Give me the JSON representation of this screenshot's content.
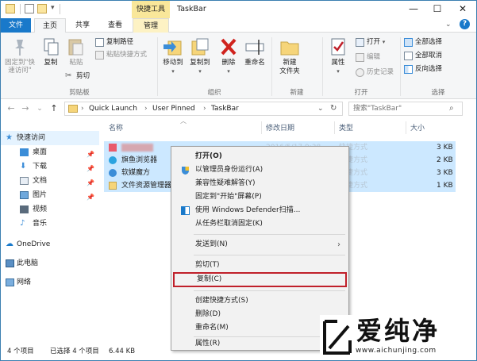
{
  "titlebar": {
    "contextual_tab": "快捷工具",
    "title": "TaskBar",
    "min": "—",
    "max": "☐",
    "close": "✕"
  },
  "tabs": {
    "file": "文件",
    "home": "主页",
    "share": "共享",
    "view": "查看",
    "manage": "管理"
  },
  "ribbon": {
    "clipboard": {
      "pin": "固定到\"快\n速访问\"",
      "copy": "复制",
      "paste": "粘贴",
      "copy_path": "复制路径",
      "paste_shortcut": "粘贴快捷方式",
      "cut": "剪切",
      "label": "剪贴板"
    },
    "organize": {
      "move_to": "移动到",
      "copy_to": "复制到",
      "delete": "删除",
      "rename": "重命名",
      "label": "组织"
    },
    "new": {
      "new_folder": "新建\n文件夹",
      "label": "新建"
    },
    "open": {
      "properties": "属性",
      "open": "打开",
      "edit": "编辑",
      "history": "历史记录",
      "label": "打开"
    },
    "select": {
      "select_all": "全部选择",
      "select_none": "全部取消",
      "invert": "反向选择",
      "label": "选择"
    }
  },
  "navbar": {
    "back": "←",
    "forward": "→",
    "recent": "⌄",
    "up": "↑",
    "breadcrumb": [
      "Quick Launch",
      "User Pinned",
      "TaskBar"
    ],
    "crumb_sep": "›",
    "search_placeholder": "搜索\"TaskBar\""
  },
  "sidebar": {
    "quick_access": "快速访问",
    "items": [
      "桌面",
      "下载",
      "文档",
      "图片",
      "视频",
      "音乐"
    ],
    "onedrive": "OneDrive",
    "this_pc": "此电脑",
    "network": "网络"
  },
  "filelist": {
    "headers": {
      "name": "名称",
      "modified": "修改日期",
      "type": "类型",
      "size": "大小"
    },
    "rows": [
      {
        "name": "",
        "modified": "2016/5/17 9:38",
        "type": "快捷方式",
        "size": "3 KB"
      },
      {
        "name": "旗鱼浏览器",
        "modified": "",
        "type": "快捷方式",
        "size": "2 KB"
      },
      {
        "name": "软媒魔方",
        "modified": "",
        "type": "快捷方式",
        "size": "3 KB"
      },
      {
        "name": "文件资源管理器",
        "modified": "",
        "type": "快捷方式",
        "size": "1 KB"
      }
    ]
  },
  "status": {
    "count": "4 个项目",
    "selected": "已选择 4 个项目",
    "size": "6.44 KB"
  },
  "context_menu": {
    "items": [
      "打开(O)",
      "以管理员身份运行(A)",
      "兼容性疑难解答(Y)",
      "固定到\"开始\"屏幕(P)",
      "使用 Windows Defender扫描...",
      "从任务栏取消固定(K)",
      "发送到(N)",
      "剪切(T)",
      "复制(C)",
      "创建快捷方式(S)",
      "删除(D)",
      "重命名(M)",
      "属性(R)"
    ]
  },
  "watermark": {
    "text": "爱纯净",
    "url": "www.aichunjing.com"
  },
  "colors": {
    "accent": "#1979ca",
    "selection": "#cce8ff",
    "highlight_box": "#c0202a",
    "contextual_tab": "#f9e79a"
  }
}
